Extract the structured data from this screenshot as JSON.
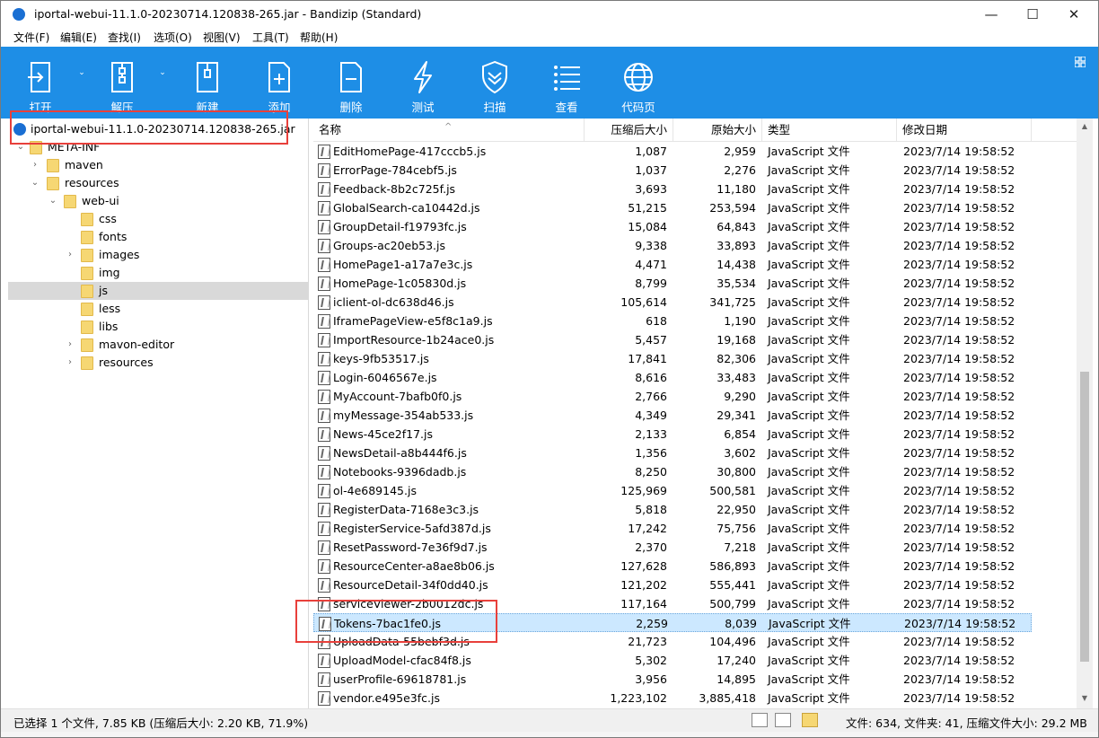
{
  "window": {
    "title": "iportal-webui-11.1.0-20230714.120838-265.jar - Bandizip (Standard)",
    "minimize": "—",
    "maximize": "☐",
    "close": "✕"
  },
  "menu": [
    "文件(F)",
    "编辑(E)",
    "查找(I)",
    "选项(O)",
    "视图(V)",
    "工具(T)",
    "帮助(H)"
  ],
  "toolbar": {
    "open": "打开",
    "extract": "解压",
    "new": "新建",
    "add": "添加",
    "delete": "删除",
    "test": "测试",
    "scan": "扫描",
    "view": "查看",
    "codepage": "代码页",
    "accent": "#1e8ee6"
  },
  "tree": {
    "root": "iportal-webui-11.1.0-20230714.120838-265.jar",
    "items": [
      "META-INF",
      "maven",
      "resources",
      "web-ui",
      "css",
      "fonts",
      "images",
      "img",
      "js",
      "less",
      "libs",
      "mavon-editor",
      "resources"
    ]
  },
  "columns": {
    "name": "名称",
    "compressed": "压缩后大小",
    "original": "原始大小",
    "type": "类型",
    "modified": "修改日期"
  },
  "files": [
    {
      "name": "EditHomePage-417cccb5.js",
      "comp": "1,087",
      "orig": "2,959",
      "type": "JavaScript 文件",
      "date": "2023/7/14 19:58:52"
    },
    {
      "name": "ErrorPage-784cebf5.js",
      "comp": "1,037",
      "orig": "2,276",
      "type": "JavaScript 文件",
      "date": "2023/7/14 19:58:52"
    },
    {
      "name": "Feedback-8b2c725f.js",
      "comp": "3,693",
      "orig": "11,180",
      "type": "JavaScript 文件",
      "date": "2023/7/14 19:58:52"
    },
    {
      "name": "GlobalSearch-ca10442d.js",
      "comp": "51,215",
      "orig": "253,594",
      "type": "JavaScript 文件",
      "date": "2023/7/14 19:58:52"
    },
    {
      "name": "GroupDetail-f19793fc.js",
      "comp": "15,084",
      "orig": "64,843",
      "type": "JavaScript 文件",
      "date": "2023/7/14 19:58:52"
    },
    {
      "name": "Groups-ac20eb53.js",
      "comp": "9,338",
      "orig": "33,893",
      "type": "JavaScript 文件",
      "date": "2023/7/14 19:58:52"
    },
    {
      "name": "HomePage1-a17a7e3c.js",
      "comp": "4,471",
      "orig": "14,438",
      "type": "JavaScript 文件",
      "date": "2023/7/14 19:58:52"
    },
    {
      "name": "HomePage-1c05830d.js",
      "comp": "8,799",
      "orig": "35,534",
      "type": "JavaScript 文件",
      "date": "2023/7/14 19:58:52"
    },
    {
      "name": "iclient-ol-dc638d46.js",
      "comp": "105,614",
      "orig": "341,725",
      "type": "JavaScript 文件",
      "date": "2023/7/14 19:58:52"
    },
    {
      "name": "IframePageView-e5f8c1a9.js",
      "comp": "618",
      "orig": "1,190",
      "type": "JavaScript 文件",
      "date": "2023/7/14 19:58:52"
    },
    {
      "name": "ImportResource-1b24ace0.js",
      "comp": "5,457",
      "orig": "19,168",
      "type": "JavaScript 文件",
      "date": "2023/7/14 19:58:52"
    },
    {
      "name": "keys-9fb53517.js",
      "comp": "17,841",
      "orig": "82,306",
      "type": "JavaScript 文件",
      "date": "2023/7/14 19:58:52"
    },
    {
      "name": "Login-6046567e.js",
      "comp": "8,616",
      "orig": "33,483",
      "type": "JavaScript 文件",
      "date": "2023/7/14 19:58:52"
    },
    {
      "name": "MyAccount-7bafb0f0.js",
      "comp": "2,766",
      "orig": "9,290",
      "type": "JavaScript 文件",
      "date": "2023/7/14 19:58:52"
    },
    {
      "name": "myMessage-354ab533.js",
      "comp": "4,349",
      "orig": "29,341",
      "type": "JavaScript 文件",
      "date": "2023/7/14 19:58:52"
    },
    {
      "name": "News-45ce2f17.js",
      "comp": "2,133",
      "orig": "6,854",
      "type": "JavaScript 文件",
      "date": "2023/7/14 19:58:52"
    },
    {
      "name": "NewsDetail-a8b444f6.js",
      "comp": "1,356",
      "orig": "3,602",
      "type": "JavaScript 文件",
      "date": "2023/7/14 19:58:52"
    },
    {
      "name": "Notebooks-9396dadb.js",
      "comp": "8,250",
      "orig": "30,800",
      "type": "JavaScript 文件",
      "date": "2023/7/14 19:58:52"
    },
    {
      "name": "ol-4e689145.js",
      "comp": "125,969",
      "orig": "500,581",
      "type": "JavaScript 文件",
      "date": "2023/7/14 19:58:52"
    },
    {
      "name": "RegisterData-7168e3c3.js",
      "comp": "5,818",
      "orig": "22,950",
      "type": "JavaScript 文件",
      "date": "2023/7/14 19:58:52"
    },
    {
      "name": "RegisterService-5afd387d.js",
      "comp": "17,242",
      "orig": "75,756",
      "type": "JavaScript 文件",
      "date": "2023/7/14 19:58:52"
    },
    {
      "name": "ResetPassword-7e36f9d7.js",
      "comp": "2,370",
      "orig": "7,218",
      "type": "JavaScript 文件",
      "date": "2023/7/14 19:58:52"
    },
    {
      "name": "ResourceCenter-a8ae8b06.js",
      "comp": "127,628",
      "orig": "586,893",
      "type": "JavaScript 文件",
      "date": "2023/7/14 19:58:52"
    },
    {
      "name": "ResourceDetail-34f0dd40.js",
      "comp": "121,202",
      "orig": "555,441",
      "type": "JavaScript 文件",
      "date": "2023/7/14 19:58:52"
    },
    {
      "name": "serviceViewer-2b0012dc.js",
      "comp": "117,164",
      "orig": "500,799",
      "type": "JavaScript 文件",
      "date": "2023/7/14 19:58:52"
    },
    {
      "name": "Tokens-7bac1fe0.js",
      "comp": "2,259",
      "orig": "8,039",
      "type": "JavaScript 文件",
      "date": "2023/7/14 19:58:52"
    },
    {
      "name": "UploadData-55bebf3d.js",
      "comp": "21,723",
      "orig": "104,496",
      "type": "JavaScript 文件",
      "date": "2023/7/14 19:58:52"
    },
    {
      "name": "UploadModel-cfac84f8.js",
      "comp": "5,302",
      "orig": "17,240",
      "type": "JavaScript 文件",
      "date": "2023/7/14 19:58:52"
    },
    {
      "name": "userProfile-69618781.js",
      "comp": "3,956",
      "orig": "14,895",
      "type": "JavaScript 文件",
      "date": "2023/7/14 19:58:52"
    },
    {
      "name": "vendor.e495e3fc.js",
      "comp": "1,223,102",
      "orig": "3,885,418",
      "type": "JavaScript 文件",
      "date": "2023/7/14 19:58:52"
    }
  ],
  "status": {
    "left": "已选择 1 个文件, 7.85 KB (压缩后大小: 2.20 KB, 71.9%)",
    "right": "文件: 634, 文件夹: 41, 压缩文件大小: 29.2 MB"
  }
}
